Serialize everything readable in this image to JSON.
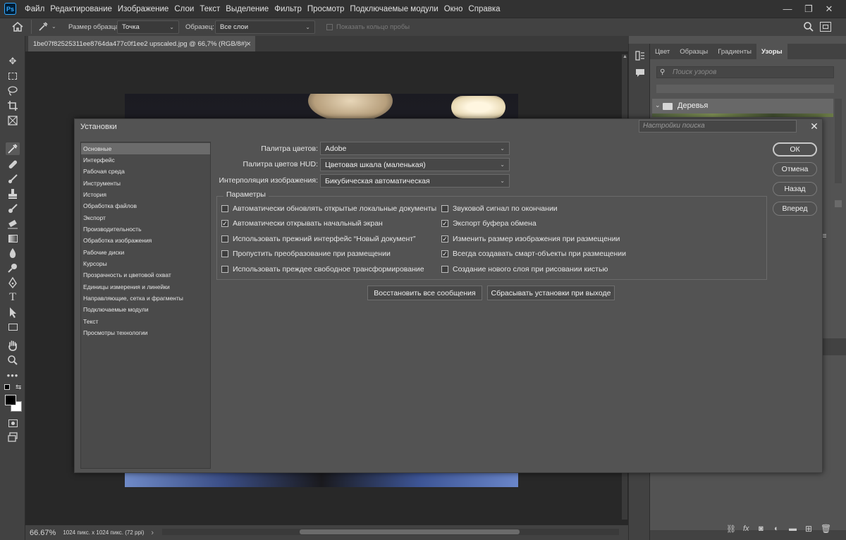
{
  "menubar": {
    "items": [
      "Файл",
      "Редактирование",
      "Изображение",
      "Слои",
      "Текст",
      "Выделение",
      "Фильтр",
      "Просмотр",
      "Подключаемые модули",
      "Окно",
      "Справка"
    ],
    "logo_text": "Ps"
  },
  "options_bar": {
    "sample_size_label": "Размер образца:",
    "sample_size_value": "Точка",
    "sample_label": "Образец:",
    "sample_value": "Все слои",
    "show_ring_label": "Показать кольцо пробы"
  },
  "document": {
    "tab_title": "1be07f82525311ee8764da477c0f1ee2 upscaled.jpg @ 66,7% (RGB/8#)",
    "tab_close": "×"
  },
  "statusbar": {
    "zoom": "66.67%",
    "info": "1024 пикс. x 1024 пикс. (72 ppi)",
    "arrow": "›"
  },
  "right_panel": {
    "tabs": [
      "Цвет",
      "Образцы",
      "Градиенты",
      "Узоры"
    ],
    "active_tab": "Узоры",
    "search_placeholder": "Поиск узоров",
    "folder_name": "Деревья"
  },
  "dialog": {
    "title": "Установки",
    "search_placeholder": "Настройки поиска",
    "close": "✕",
    "nav": [
      "Основные",
      "Интерфейс",
      "Рабочая среда",
      "Инструменты",
      "История",
      "Обработка файлов",
      "Экспорт",
      "Производительность",
      "Обработка изображения",
      "Рабочие диски",
      "Курсоры",
      "Прозрачность и цветовой охват",
      "Единицы измерения и линейки",
      "Направляющие, сетка и фрагменты",
      "Подключаемые модули",
      "Текст",
      "Просмотры технологии"
    ],
    "selected_nav": "Основные",
    "fields": {
      "color_picker_label": "Палитра цветов:",
      "color_picker_value": "Adobe",
      "hud_picker_label": "Палитра цветов HUD:",
      "hud_picker_value": "Цветовая шкала (маленькая)",
      "interp_label": "Интерполяция изображения:",
      "interp_value": "Бикубическая автоматическая"
    },
    "params_title": "Параметры",
    "checkboxes_left": [
      {
        "label": "Автоматически обновлять открытые локальные документы",
        "checked": false
      },
      {
        "label": "Автоматически открывать начальный экран",
        "checked": true
      },
      {
        "label": "Использовать прежний интерфейс “Новый документ”",
        "checked": false
      },
      {
        "label": "Пропустить преобразование при размещении",
        "checked": false
      },
      {
        "label": "Использовать преждее свободное трансформирование",
        "checked": false
      }
    ],
    "checkboxes_right": [
      {
        "label": "Звуковой сигнал по окончании",
        "checked": false
      },
      {
        "label": "Экспорт буфера обмена",
        "checked": true
      },
      {
        "label": "Изменить размер изображения при размещении",
        "checked": true
      },
      {
        "label": "Всегда создавать смарт-объекты при размещении",
        "checked": true
      },
      {
        "label": "Создание нового слоя при рисовании кистью",
        "checked": false
      }
    ],
    "reset_messages_button": "Восстановить все сообщения",
    "reset_on_quit_button": "Сбрасывать установки при выходе",
    "ok_button": "ОК",
    "cancel_button": "Отмена",
    "back_button": "Назад",
    "forward_button": "Вперед"
  }
}
